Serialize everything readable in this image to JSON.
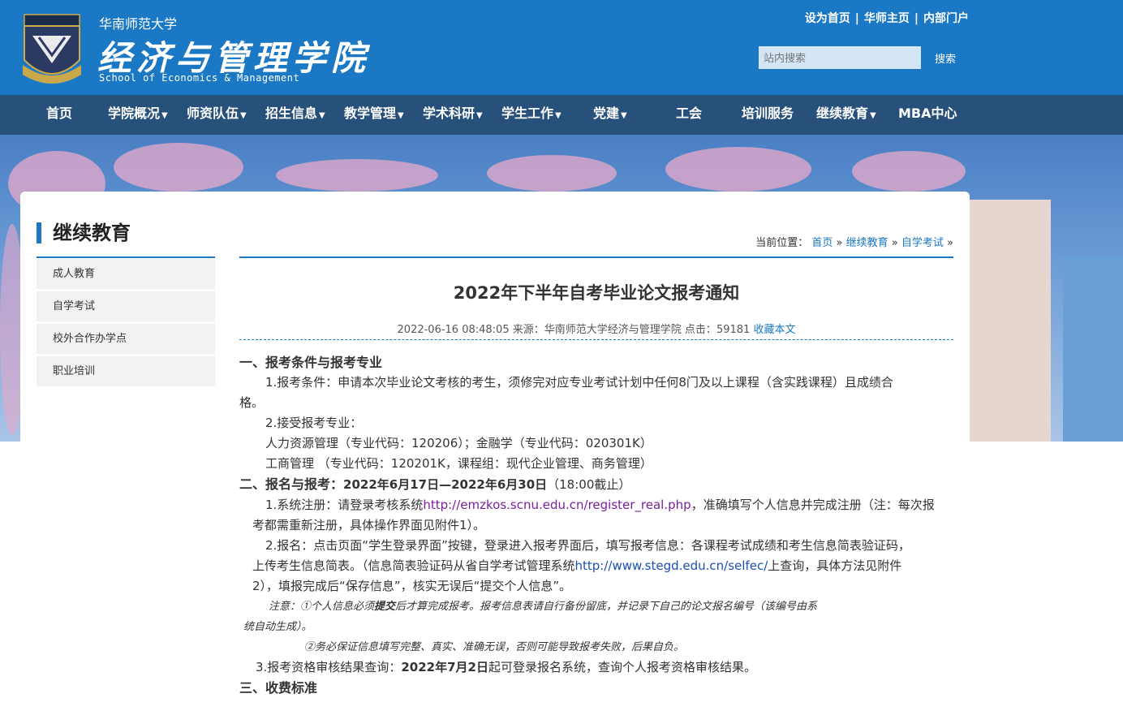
{
  "header": {
    "university": "华南师范大学",
    "college_cn": "经济与管理学院",
    "college_en": "School of Economics & Management",
    "top_links": [
      "设为首页",
      "华师主页",
      "内部门户"
    ],
    "search_placeholder": "站内搜索",
    "search_button": "搜索"
  },
  "nav": [
    {
      "label": "首页",
      "dropdown": false
    },
    {
      "label": "学院概况",
      "dropdown": true
    },
    {
      "label": "师资队伍",
      "dropdown": true
    },
    {
      "label": "招生信息",
      "dropdown": true
    },
    {
      "label": "教学管理",
      "dropdown": true
    },
    {
      "label": "学术科研",
      "dropdown": true
    },
    {
      "label": "学生工作",
      "dropdown": true
    },
    {
      "label": "党建",
      "dropdown": true
    },
    {
      "label": "工会",
      "dropdown": false
    },
    {
      "label": "培训服务",
      "dropdown": false
    },
    {
      "label": "继续教育",
      "dropdown": true
    },
    {
      "label": "MBA中心",
      "dropdown": false
    }
  ],
  "sidebar": {
    "title": "继续教育",
    "items": [
      "成人教育",
      "自学考试",
      "校外合作办学点",
      "职业培训"
    ]
  },
  "breadcrumb": {
    "prefix": "当前位置：",
    "items": [
      "首页",
      "继续教育",
      "自学考试"
    ],
    "sep": "»"
  },
  "article": {
    "title": "2022年下半年自考毕业论文报考通知",
    "date": "2022-06-16 08:48:05",
    "source_label": "来源：",
    "source": "华南师范大学经济与管理学院",
    "hits_label": "点击：",
    "hits": "59181",
    "favorite": "收藏本文",
    "s1_title": "一、报考条件与报考专业",
    "s1_p1": "1.报考条件：申请本次毕业论文考核的考生，须修完对应专业考试计划中任何8门及以上课程（含实践课程）且成绩合",
    "s1_p1b": "格。",
    "s1_p2": "2.接受报考专业：",
    "s1_p3": "人力资源管理（专业代码：120206）；金融学（专业代码：020301K）",
    "s1_p4": "工商管理 （专业代码：120201K，课程组：现代企业管理、商务管理）",
    "s2_title": "二、报名与报考：",
    "s2_dates": "2022年6月17日—2022年6月30日",
    "s2_time": "（18:00截止）",
    "s2_p1a": "1.系统注册：请登录考核系统",
    "s2_p1_link": "http://emzkos.scnu.edu.cn/register_real.php",
    "s2_p1b": "，准确填写个人信息并完成注册（注：每次报",
    "s2_p1c": "考都需重新注册，具体操作界面见附件1）。",
    "s2_p2a": "2.报名：点击页面“学生登录界面”按键，登录进入报考界面后，填写报考信息：各课程考试成绩和考生信息简表验证码，",
    "s2_p2b": "上传考生信息简表。（信息简表验证码从省自学考试管理系统",
    "s2_p2_link": "http://www.stegd.edu.cn/selfec/",
    "s2_p2c": "上查询，具体方法见附件",
    "s2_p2d": "2），填报完成后“保存信息”，核实无误后“提交个人信息”。",
    "note1a": "注意：①个人信息必须",
    "note1_bold": "提交",
    "note1b": "后才算完成报考。报考信息表请自行备份留底，并记录下自己的论文报名编号（该编号由系",
    "note1c": "统自动生成）。",
    "note2": "②务必保证信息填写完整、真实、准确无误，否则可能导致报考失败，后果自负。",
    "s2_p3a": "3.报考资格审核结果查询：",
    "s2_p3_bold": "2022年7月2日",
    "s2_p3b": "起可登录报名系统，查询个人报考资格审核结果。",
    "s3_title": "三、收费标准"
  }
}
